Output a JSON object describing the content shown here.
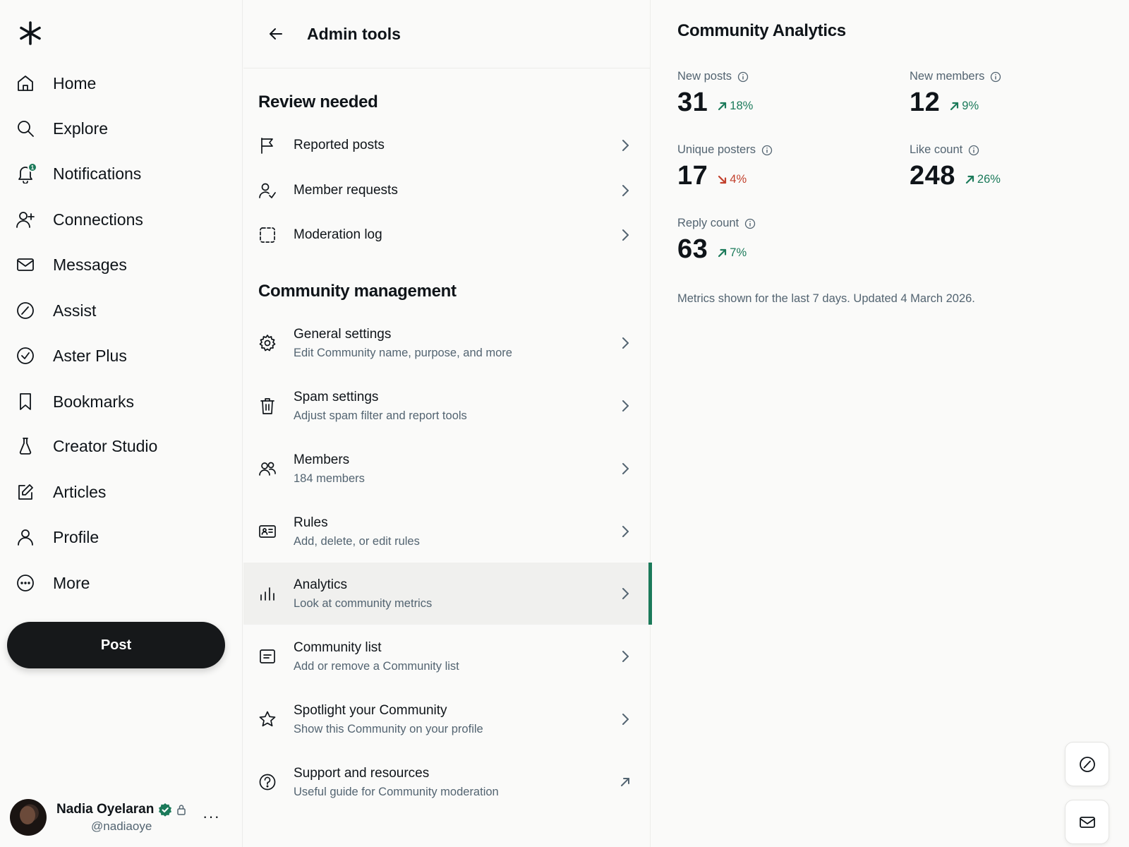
{
  "sidebar": {
    "logo_icon": "asterisk-logo",
    "items": [
      {
        "label": "Home",
        "icon": "home-icon"
      },
      {
        "label": "Explore",
        "icon": "search-icon"
      },
      {
        "label": "Notifications",
        "icon": "bell-icon",
        "badge": "1"
      },
      {
        "label": "Connections",
        "icon": "person-add-icon"
      },
      {
        "label": "Messages",
        "icon": "mail-icon"
      },
      {
        "label": "Assist",
        "icon": "slash-circle-icon"
      },
      {
        "label": "Aster Plus",
        "icon": "check-circle-icon"
      },
      {
        "label": "Bookmarks",
        "icon": "bookmark-icon"
      },
      {
        "label": "Creator Studio",
        "icon": "flask-icon"
      },
      {
        "label": "Articles",
        "icon": "compose-icon"
      },
      {
        "label": "Profile",
        "icon": "person-icon"
      },
      {
        "label": "More",
        "icon": "more-circle-icon"
      }
    ],
    "post_label": "Post",
    "account": {
      "name": "Nadia Oyelaran",
      "handle": "@nadiaoye",
      "more": "···"
    }
  },
  "admin": {
    "title": "Admin tools",
    "review_title": "Review needed",
    "review_items": [
      {
        "label": "Reported posts",
        "icon": "flag-icon"
      },
      {
        "label": "Member requests",
        "icon": "person-check-icon"
      },
      {
        "label": "Moderation log",
        "icon": "dashed-square-icon"
      }
    ],
    "management_title": "Community management",
    "management_items": [
      {
        "label": "General settings",
        "sub": "Edit Community name, purpose, and more",
        "icon": "gear-icon"
      },
      {
        "label": "Spam settings",
        "sub": "Adjust spam filter and report tools",
        "icon": "trash-icon"
      },
      {
        "label": "Members",
        "sub": "184 members",
        "icon": "people-icon"
      },
      {
        "label": "Rules",
        "sub": "Add, delete, or edit rules",
        "icon": "id-card-icon"
      },
      {
        "label": "Analytics",
        "sub": "Look at community metrics",
        "icon": "bar-chart-icon",
        "active": true
      },
      {
        "label": "Community list",
        "sub": "Add or remove a Community list",
        "icon": "list-icon"
      },
      {
        "label": "Spotlight your Community",
        "sub": "Show this Community on your profile",
        "icon": "star-icon"
      },
      {
        "label": "Support and resources",
        "sub": "Useful guide for Community moderation",
        "icon": "help-circle-icon",
        "external": true
      }
    ]
  },
  "analytics": {
    "title": "Community Analytics",
    "metrics": [
      {
        "label": "New posts",
        "value": "31",
        "change": "18%",
        "direction": "up"
      },
      {
        "label": "New members",
        "value": "12",
        "change": "9%",
        "direction": "up"
      },
      {
        "label": "Unique posters",
        "value": "17",
        "change": "4%",
        "direction": "down"
      },
      {
        "label": "Like count",
        "value": "248",
        "change": "26%",
        "direction": "up"
      },
      {
        "label": "Reply count",
        "value": "63",
        "change": "7%",
        "direction": "up"
      }
    ],
    "footnote": "Metrics shown for the last 7 days. Updated 4 March 2026."
  },
  "colors": {
    "accent": "#1b7a5a",
    "negative": "#c2412d",
    "text": "#0f1419",
    "muted": "#536471",
    "post_button": "#16181a"
  }
}
